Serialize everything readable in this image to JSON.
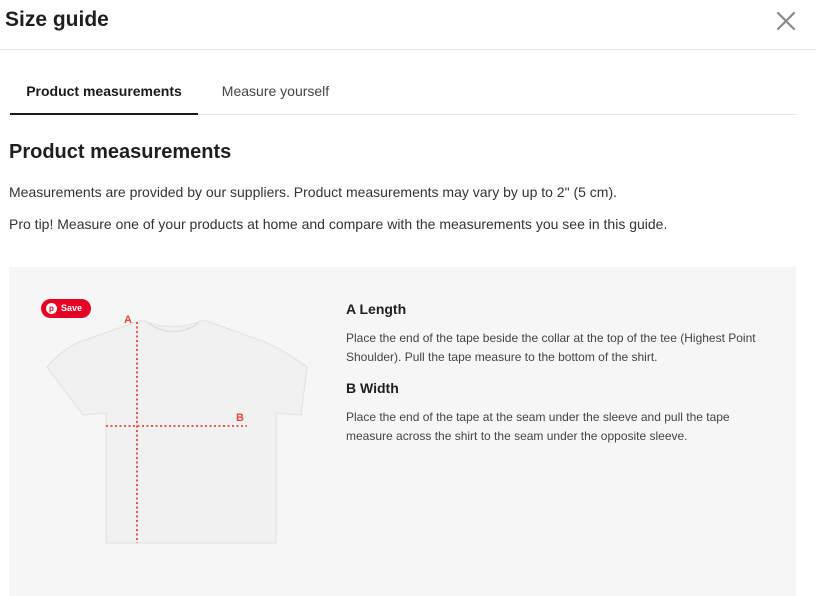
{
  "modal": {
    "title": "Size guide"
  },
  "tabs": [
    {
      "label": "Product measurements",
      "active": true
    },
    {
      "label": "Measure yourself",
      "active": false
    }
  ],
  "section": {
    "title": "Product measurements",
    "paragraphs": [
      "Measurements are provided by our suppliers. Product measurements may vary by up to 2\" (5 cm).",
      "Pro tip! Measure one of your products at home and compare with the measurements you see in this guide."
    ]
  },
  "diagram": {
    "save_label": "Save",
    "marker_a": "A",
    "marker_b": "B",
    "measure_color": "#e8473c",
    "badge_color": "#e60023"
  },
  "measurements": [
    {
      "title": "A Length",
      "description": "Place the end of the tape beside the collar at the top of the tee (Highest Point Shoulder). Pull the tape measure to the bottom of the shirt."
    },
    {
      "title": "B Width",
      "description": "Place the end of the tape at the seam under the sleeve and pull the tape measure across the shirt to the seam under the opposite sleeve."
    }
  ]
}
